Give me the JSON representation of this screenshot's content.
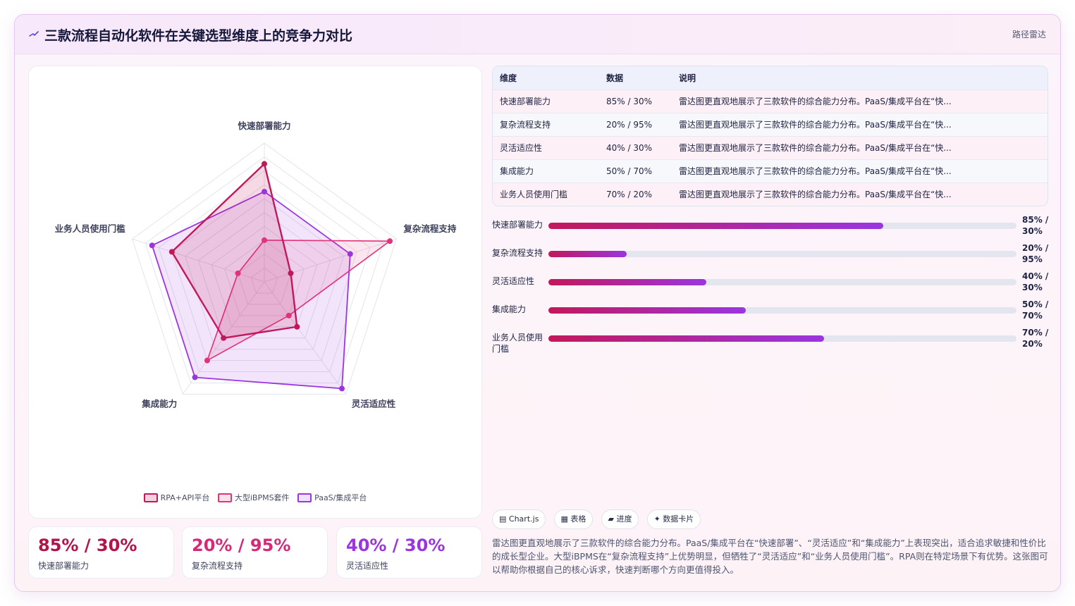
{
  "header": {
    "title": "三款流程自动化软件在关键选型维度上的竞争力对比",
    "tag": "路径雷达"
  },
  "colors": {
    "rpa": "#c2185b",
    "ibpms": "#e0337a",
    "paas": "#9b35e0"
  },
  "chart_data": {
    "type": "radar",
    "axes": [
      "快速部署能力",
      "复杂流程支持",
      "灵活适应性",
      "集成能力",
      "业务人员使用门槛"
    ],
    "series": [
      {
        "name": "RPA+API平台",
        "values": [
          85,
          20,
          40,
          50,
          70
        ]
      },
      {
        "name": "大型iBPMS套件",
        "values": [
          30,
          95,
          30,
          70,
          20
        ]
      },
      {
        "name": "PaaS/集成平台",
        "values": [
          65,
          65,
          95,
          85,
          85
        ]
      }
    ],
    "rmax": 100,
    "grid_levels": 10,
    "legend_position": "bottom"
  },
  "table": {
    "headers": [
      "维度",
      "数据",
      "说明"
    ],
    "rows": [
      {
        "dim": "快速部署能力",
        "data": "85% / 30%",
        "desc": "雷达图更直观地展示了三款软件的综合能力分布。PaaS/集成平台在“快..."
      },
      {
        "dim": "复杂流程支持",
        "data": "20% / 95%",
        "desc": "雷达图更直观地展示了三款软件的综合能力分布。PaaS/集成平台在“快..."
      },
      {
        "dim": "灵活适应性",
        "data": "40% / 30%",
        "desc": "雷达图更直观地展示了三款软件的综合能力分布。PaaS/集成平台在“快..."
      },
      {
        "dim": "集成能力",
        "data": "50% / 70%",
        "desc": "雷达图更直观地展示了三款软件的综合能力分布。PaaS/集成平台在“快..."
      },
      {
        "dim": "业务人员使用门槛",
        "data": "70% / 20%",
        "desc": "雷达图更直观地展示了三款软件的综合能力分布。PaaS/集成平台在“快..."
      }
    ]
  },
  "progress": [
    {
      "label": "快速部署能力",
      "value_text": "85% / 30%",
      "fill": 0.716
    },
    {
      "label": "复杂流程支持",
      "value_text": "20% / 95%",
      "fill": 0.167
    },
    {
      "label": "灵活适应性",
      "value_text": "40% / 30%",
      "fill": 0.337
    },
    {
      "label": "集成能力",
      "value_text": "50% / 70%",
      "fill": 0.421
    },
    {
      "label": "业务人员使用门槛",
      "value_text": "70% / 20%",
      "fill": 0.589
    }
  ],
  "stats": [
    {
      "value": "85% / 30%",
      "label": "快速部署能力",
      "color": "#b3124a"
    },
    {
      "value": "20% / 95%",
      "label": "复杂流程支持",
      "color": "#d62a78"
    },
    {
      "value": "40% / 30%",
      "label": "灵活适应性",
      "color": "#9b35e0"
    }
  ],
  "chips": [
    {
      "icon": "chart-icon",
      "glyph": "▤",
      "label": "Chart.js"
    },
    {
      "icon": "table-icon",
      "glyph": "▦",
      "label": "表格"
    },
    {
      "icon": "progress-icon",
      "glyph": "▰",
      "label": "进度"
    },
    {
      "icon": "sparkle-icon",
      "glyph": "✦",
      "label": "数据卡片"
    }
  ],
  "summary": "雷达图更直观地展示了三款软件的综合能力分布。PaaS/集成平台在“快速部署”、“灵活适应”和“集成能力”上表现突出，适合追求敏捷和性价比的成长型企业。大型iBPMS在“复杂流程支持”上优势明显，但牺牲了“灵活适应”和“业务人员使用门槛”。RPA则在特定场景下有优势。这张图可以帮助你根据自己的核心诉求，快速判断哪个方向更值得投入。"
}
